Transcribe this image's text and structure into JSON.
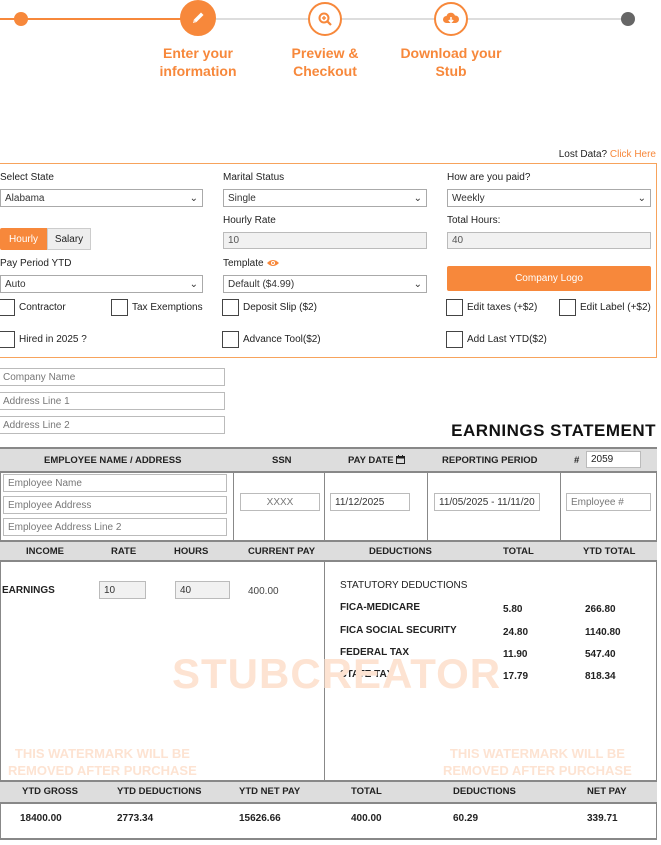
{
  "stepper": {
    "steps": [
      {
        "label": "Enter your\ninformation",
        "icon": "pencil-icon"
      },
      {
        "label": "Preview &\nCheckout",
        "icon": "magnify-icon"
      },
      {
        "label": "Download your\nStub",
        "icon": "download-icon"
      }
    ]
  },
  "lost_data": {
    "text": "Lost Data?",
    "link": "Click Here"
  },
  "form": {
    "state": {
      "label": "Select State",
      "value": "Alabama"
    },
    "marital": {
      "label": "Marital Status",
      "value": "Single"
    },
    "paid": {
      "label": "How are you paid?",
      "value": "Weekly"
    },
    "pay_type": {
      "hourly": "Hourly",
      "salary": "Salary"
    },
    "hourly_rate": {
      "label": "Hourly Rate",
      "value": "10"
    },
    "total_hours": {
      "label": "Total Hours:",
      "value": "40"
    },
    "pay_period_ytd": {
      "label": "Pay Period YTD",
      "value": "Auto"
    },
    "template": {
      "label": "Template",
      "value": "Default ($4.99)"
    },
    "company_logo": "Company Logo",
    "checkboxes": {
      "contractor": "Contractor",
      "tax_exemptions": "Tax Exemptions",
      "deposit_slip": "Deposit Slip ($2)",
      "edit_taxes": "Edit taxes (+$2)",
      "edit_label": "Edit Label (+$2)",
      "hired_2025": "Hired in 2025 ?",
      "advance_tool": "Advance Tool($2)",
      "add_last_ytd": "Add Last YTD($2)"
    }
  },
  "company": {
    "name_placeholder": "Company Name",
    "address1_placeholder": "Address Line 1",
    "address2_placeholder": "Address Line 2"
  },
  "statement": {
    "title": "EARNINGS STATEMENT",
    "headers": {
      "employee": "EMPLOYEE NAME / ADDRESS",
      "ssn": "SSN",
      "pay_date": "PAY DATE",
      "period": "REPORTING PERIOD",
      "number": "#"
    },
    "stub_number": "2059",
    "employee_name_placeholder": "Employee Name",
    "employee_address_placeholder": "Employee Address",
    "employee_address2_placeholder": "Employee Address Line 2",
    "ssn": "XXXX",
    "pay_date": "11/12/2025",
    "period": "11/05/2025 - 11/11/20",
    "employee_number_placeholder": "Employee #",
    "earn_headers": {
      "income": "INCOME",
      "rate": "RATE",
      "hours": "HOURS",
      "current": "CURRENT PAY",
      "deductions": "DEDUCTIONS",
      "total": "TOTAL",
      "ytd_total": "YTD TOTAL"
    },
    "earnings": {
      "label": "EARNINGS",
      "rate": "10",
      "hours": "40",
      "current": "400.00"
    },
    "deductions_title": "STATUTORY DEDUCTIONS",
    "deductions": [
      {
        "name": "FICA-MEDICARE",
        "total": "5.80",
        "ytd": "266.80"
      },
      {
        "name": "FICA SOCIAL SECURITY",
        "total": "24.80",
        "ytd": "1140.80"
      },
      {
        "name": "FEDERAL TAX",
        "total": "11.90",
        "ytd": "547.40"
      },
      {
        "name": "STATE TAX",
        "total": "17.79",
        "ytd": "818.34"
      }
    ],
    "watermark": "STUBCREATOR",
    "watermark_note": "THIS WATERMARK WILL BE\nREMOVED AFTER PURCHASE",
    "summary_headers": {
      "ytd_gross": "YTD GROSS",
      "ytd_deductions": "YTD DEDUCTIONS",
      "ytd_net": "YTD NET PAY",
      "total": "TOTAL",
      "deductions": "DEDUCTIONS",
      "net_pay": "NET PAY"
    },
    "summary": {
      "ytd_gross": "18400.00",
      "ytd_deductions": "2773.34",
      "ytd_net": "15626.66",
      "total": "400.00",
      "deductions": "60.29",
      "net_pay": "339.71"
    }
  },
  "colors": {
    "accent": "#f7883b",
    "step_inactive": "#dddddd",
    "header_bg": "#dddddd"
  }
}
